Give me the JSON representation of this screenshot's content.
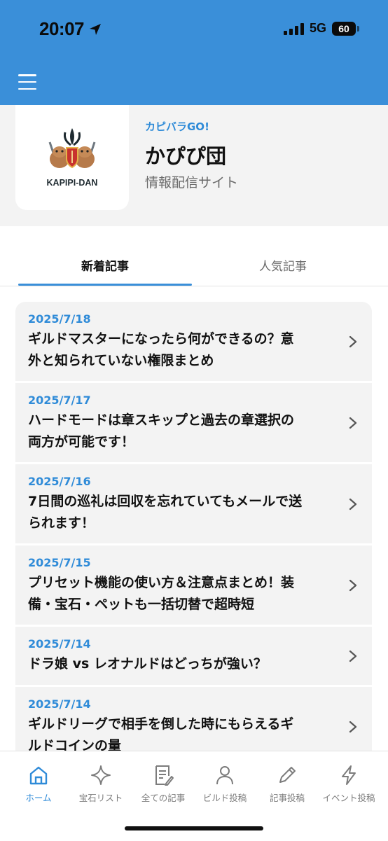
{
  "status_bar": {
    "time": "20:07",
    "network": "5G",
    "battery": "60",
    "location_icon": "location-arrow-icon",
    "signal_icon": "cellular-signal-icon"
  },
  "header": {
    "background_color": "#3a8fd9",
    "menu_icon": "hamburger-menu-icon"
  },
  "profile": {
    "logo_text": "KAPIPI-DAN",
    "subtitle": "カピバラGO!",
    "title": "かぴぴ団",
    "description": "情報配信サイト"
  },
  "tabs": [
    {
      "label": "新着記事",
      "active": true
    },
    {
      "label": "人気記事",
      "active": false
    }
  ],
  "articles": [
    {
      "date": "2025/7/18",
      "title_lines": [
        "ギルドマスターになったら何ができるの？意",
        "外と知られていない権限まとめ"
      ]
    },
    {
      "date": "2025/7/17",
      "title_lines": [
        "ハードモードは章スキップと過去の章選択の",
        "両方が可能です！"
      ]
    },
    {
      "date": "2025/7/16",
      "title_lines": [
        "7日間の巡礼は回収を忘れていてもメールで送",
        "られます！"
      ]
    },
    {
      "date": "2025/7/15",
      "title_lines": [
        "プリセット機能の使い方＆注意点まとめ！装",
        "備・宝石・ペットも一括切替で超時短"
      ]
    },
    {
      "date": "2025/7/14",
      "title_lines": [
        "ドラ娘 vs レオナルドはどっちが強い？"
      ]
    },
    {
      "date": "2025/7/14",
      "title_lines": [
        "ギルドリーグで相手を倒した時にもらえるギ",
        "ルドコインの量"
      ]
    }
  ],
  "bottom_nav": [
    {
      "label": "ホーム",
      "icon": "home-icon",
      "active": true
    },
    {
      "label": "宝石リスト",
      "icon": "sparkle-icon",
      "active": false
    },
    {
      "label": "全ての記事",
      "icon": "document-list-icon",
      "active": false
    },
    {
      "label": "ビルド投稿",
      "icon": "user-icon",
      "active": false
    },
    {
      "label": "記事投稿",
      "icon": "pencil-icon",
      "active": false
    },
    {
      "label": "イベント投稿",
      "icon": "lightning-icon",
      "active": false
    }
  ],
  "colors": {
    "accent": "#2f8bd8",
    "card_background": "#f3f3f3",
    "nav_inactive": "#7c7c7c"
  }
}
